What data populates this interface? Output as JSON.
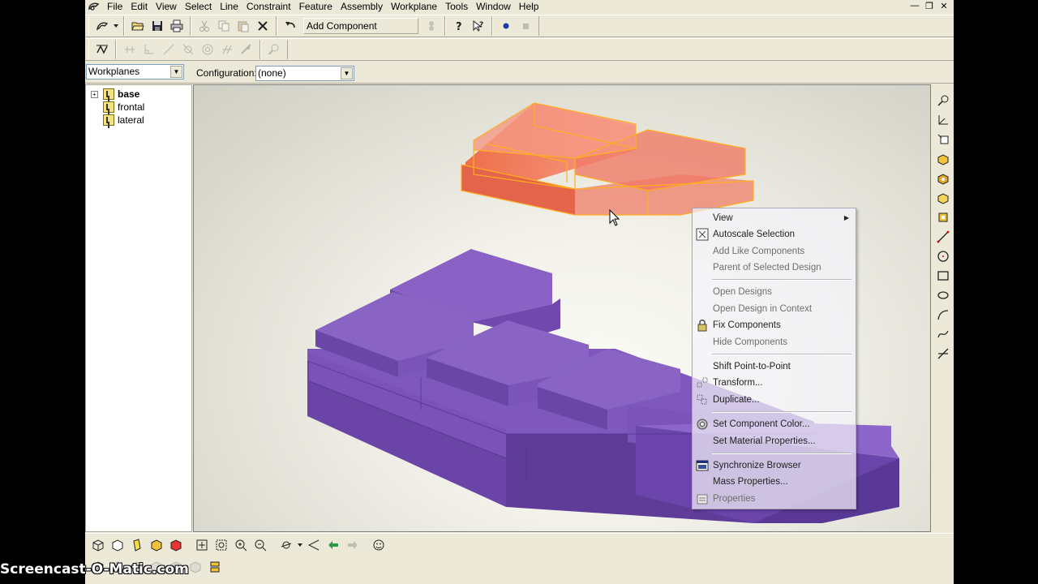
{
  "menubar": {
    "items": [
      "File",
      "Edit",
      "View",
      "Select",
      "Line",
      "Constraint",
      "Feature",
      "Assembly",
      "Workplane",
      "Tools",
      "Window",
      "Help"
    ]
  },
  "toolbar": {
    "add_component_label": "Add Component"
  },
  "workplanes_select": {
    "value": "Workplanes"
  },
  "configuration": {
    "label": "Configuration:",
    "value": "(none)"
  },
  "tree": {
    "items": [
      {
        "label": "base",
        "bold": true,
        "expandable": true
      },
      {
        "label": "frontal",
        "bold": false,
        "expandable": false
      },
      {
        "label": "lateral",
        "bold": false,
        "expandable": false
      }
    ]
  },
  "context_menu": {
    "items": [
      {
        "label": "View",
        "submenu": true,
        "disabled": false,
        "icon": ""
      },
      {
        "label": "Autoscale Selection",
        "disabled": false,
        "icon": "autoscale-icon"
      },
      {
        "label": "Add Like Components",
        "disabled": true,
        "icon": ""
      },
      {
        "label": "Parent of Selected Design",
        "disabled": true,
        "icon": ""
      },
      {
        "label": "Open Designs",
        "disabled": true,
        "icon": ""
      },
      {
        "label": "Open Design in Context",
        "disabled": true,
        "icon": ""
      },
      {
        "label": "Fix Components",
        "disabled": false,
        "icon": "lock-icon"
      },
      {
        "label": "Hide Components",
        "disabled": true,
        "icon": ""
      },
      {
        "label": "Shift Point-to-Point",
        "disabled": false,
        "icon": ""
      },
      {
        "label": "Transform...",
        "disabled": false,
        "icon": "transform-icon"
      },
      {
        "label": "Duplicate...",
        "disabled": false,
        "icon": "duplicate-icon"
      },
      {
        "label": "Set Component Color...",
        "disabled": false,
        "icon": "color-wheel-icon"
      },
      {
        "label": "Set Material Properties...",
        "disabled": false,
        "icon": ""
      },
      {
        "label": "Synchronize Browser",
        "disabled": false,
        "icon": "sync-browser-icon"
      },
      {
        "label": "Mass Properties...",
        "disabled": false,
        "icon": ""
      },
      {
        "label": "Properties",
        "disabled": true,
        "icon": "properties-icon"
      }
    ]
  },
  "colors": {
    "selected_part": "#f06a3c",
    "selected_outline": "#ffa020",
    "assembly_purple": "#7b52b8"
  },
  "watermark": "Screencast-O-Matic.com"
}
